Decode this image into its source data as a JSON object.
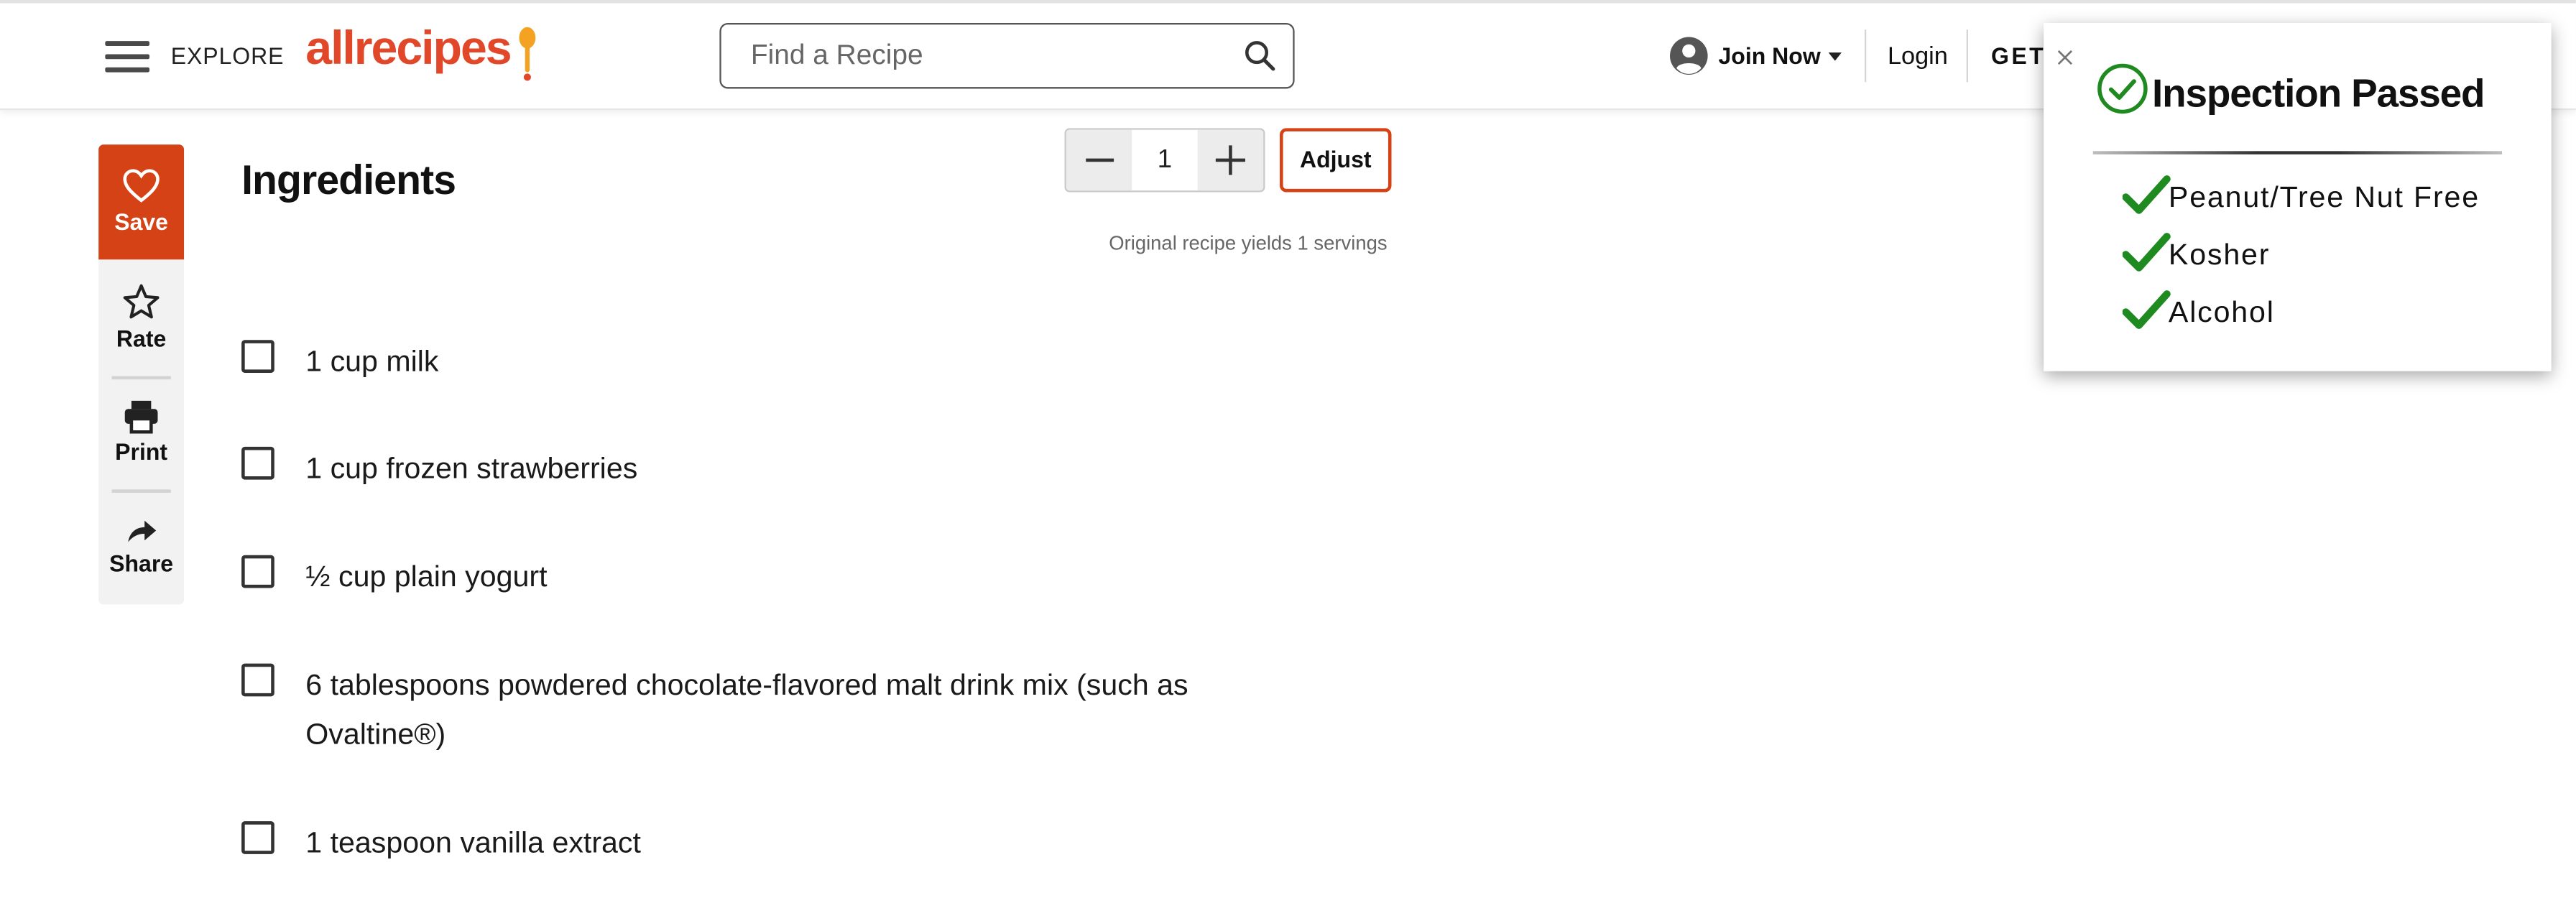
{
  "header": {
    "explore_label": "EXPLORE",
    "logo_text": "allrecipes",
    "search_placeholder": "Find a Recipe",
    "join_label": "Join Now",
    "login_label": "Login",
    "get_label": "GET"
  },
  "actions": {
    "save_label": "Save",
    "rate_label": "Rate",
    "print_label": "Print",
    "share_label": "Share"
  },
  "ingredients": {
    "title": "Ingredients",
    "servings": "1",
    "adjust_label": "Adjust",
    "yield_note": "Original recipe yields 1 servings",
    "items": [
      {
        "text": "1 cup milk"
      },
      {
        "text": "1 cup frozen strawberries"
      },
      {
        "text": "½ cup plain yogurt"
      },
      {
        "text": "6 tablespoons powdered chocolate-flavored malt drink mix (such as Ovaltine®)"
      },
      {
        "text": "1 teaspoon vanilla extract"
      }
    ]
  },
  "inspection": {
    "title": "Inspection Passed",
    "items": [
      {
        "label": "Peanut/Tree Nut Free"
      },
      {
        "label": "Kosher"
      },
      {
        "label": "Alcohol"
      }
    ]
  },
  "colors": {
    "brand": "#e1482a",
    "save_bg": "#d54215",
    "check_green": "#1f8a1f"
  },
  "icons": {
    "menu": "hamburger-menu-icon",
    "search": "search-icon",
    "account": "account-circle-icon",
    "save": "heart-icon",
    "rate": "star-icon",
    "print": "printer-icon",
    "share": "share-arrow-icon",
    "close": "close-icon",
    "passed": "check-circle-icon",
    "item_check": "checkmark-icon"
  }
}
